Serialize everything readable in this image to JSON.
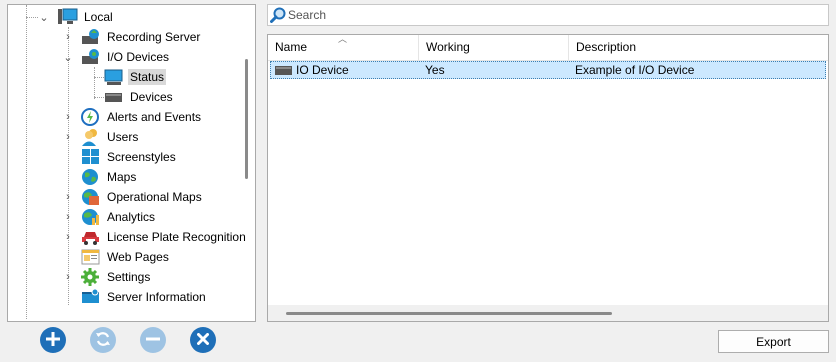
{
  "tree": {
    "nodes": [
      {
        "label": "Local",
        "icon": "computer-icon"
      },
      {
        "label": "Recording Server",
        "icon": "recording-server-icon"
      },
      {
        "label": "I/O Devices",
        "icon": "io-devices-icon"
      },
      {
        "label": "Status",
        "icon": "monitor-status-icon"
      },
      {
        "label": "Devices",
        "icon": "device-box-icon"
      },
      {
        "label": "Alerts and Events",
        "icon": "alert-bolt-icon"
      },
      {
        "label": "Users",
        "icon": "users-icon"
      },
      {
        "label": "Screenstyles",
        "icon": "screenstyles-grid-icon"
      },
      {
        "label": "Maps",
        "icon": "globe-icon"
      },
      {
        "label": "Operational Maps",
        "icon": "operational-map-icon"
      },
      {
        "label": "Analytics",
        "icon": "analytics-icon"
      },
      {
        "label": "License Plate Recognition",
        "icon": "car-icon"
      },
      {
        "label": "Web Pages",
        "icon": "web-page-icon"
      },
      {
        "label": "Settings",
        "icon": "gear-icon"
      },
      {
        "label": "Server Information",
        "icon": "server-info-icon"
      }
    ]
  },
  "search": {
    "placeholder": "Search"
  },
  "list": {
    "columns": [
      "Name",
      "Working",
      "Description"
    ],
    "rows": [
      {
        "name": "IO Device",
        "working": "Yes",
        "description": "Example of I/O Device"
      }
    ]
  },
  "buttons": {
    "add": "add-icon",
    "refresh": "refresh-icon",
    "remove": "remove-icon",
    "delete": "delete-icon",
    "export_label": "Export"
  },
  "colors": {
    "accent_blue": "#1f6fb8",
    "selection": "#cce8ff",
    "disabled": "#9ec3e3"
  }
}
